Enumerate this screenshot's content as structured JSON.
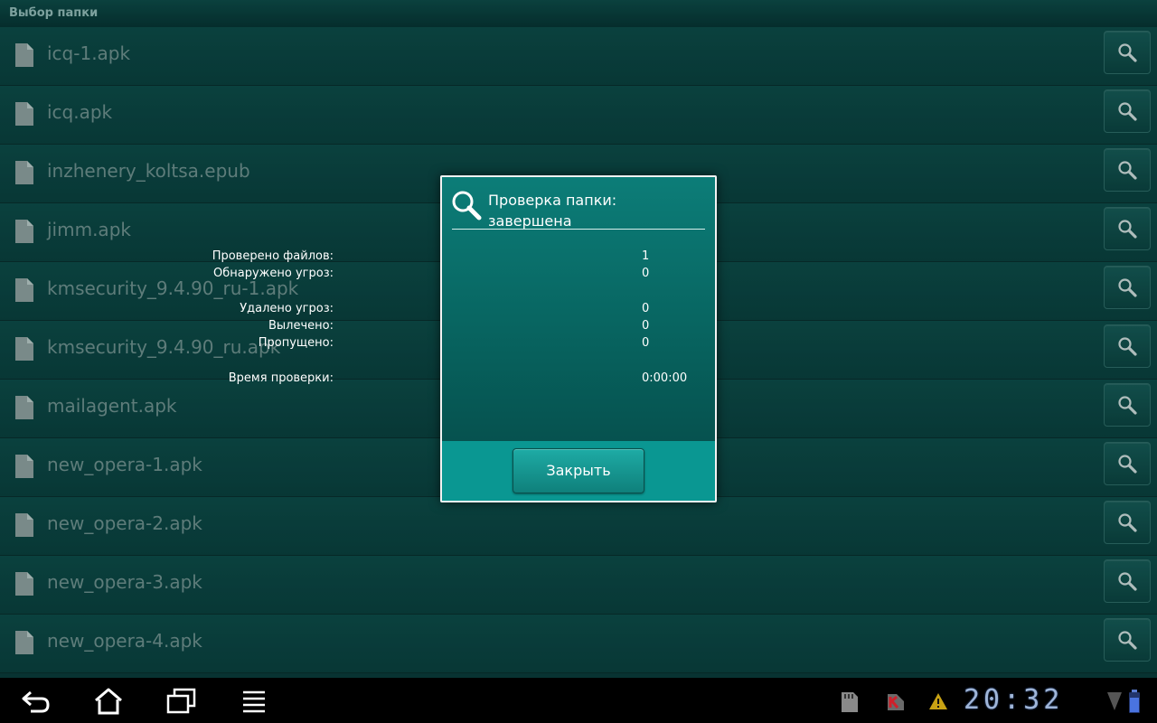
{
  "window": {
    "title": "Выбор папки"
  },
  "files": [
    {
      "name": "icq-1.apk"
    },
    {
      "name": "icq.apk"
    },
    {
      "name": "inzhenery_koltsa.epub"
    },
    {
      "name": "jimm.apk"
    },
    {
      "name": "kmsecurity_9.4.90_ru-1.apk"
    },
    {
      "name": "kmsecurity_9.4.90_ru.apk"
    },
    {
      "name": "mailagent.apk"
    },
    {
      "name": "new_opera-1.apk"
    },
    {
      "name": "new_opera-2.apk"
    },
    {
      "name": "new_opera-3.apk"
    },
    {
      "name": "new_opera-4.apk"
    }
  ],
  "dialog": {
    "title_line1": "Проверка папки:",
    "title_line2": "завершена",
    "stats": [
      {
        "label": "Проверено файлов:",
        "value": "1"
      },
      {
        "label": "Обнаружено угроз:",
        "value": "0"
      },
      {
        "label": "Удалено угроз:",
        "value": "0"
      },
      {
        "label": "Вылечено:",
        "value": "0"
      },
      {
        "label": "Пропущено:",
        "value": "0"
      },
      {
        "label": "Время проверки:",
        "value": "0:00:00"
      }
    ],
    "close_label": "Закрыть"
  },
  "statusbar": {
    "clock": "20:32",
    "icons": [
      "sd-card-icon",
      "kaspersky-icon",
      "warning-icon",
      "signal-icon",
      "battery-icon"
    ]
  },
  "navbar": {
    "buttons": [
      "back-icon",
      "home-icon",
      "recent-apps-icon",
      "menu-icon"
    ]
  },
  "colors": {
    "list_bg": "#0a3f3d",
    "dialog_bg": "#0a7a76",
    "dialog_footer": "#0a9792",
    "file_text": "#6b8e8b",
    "clock": "#9fb5d8"
  }
}
